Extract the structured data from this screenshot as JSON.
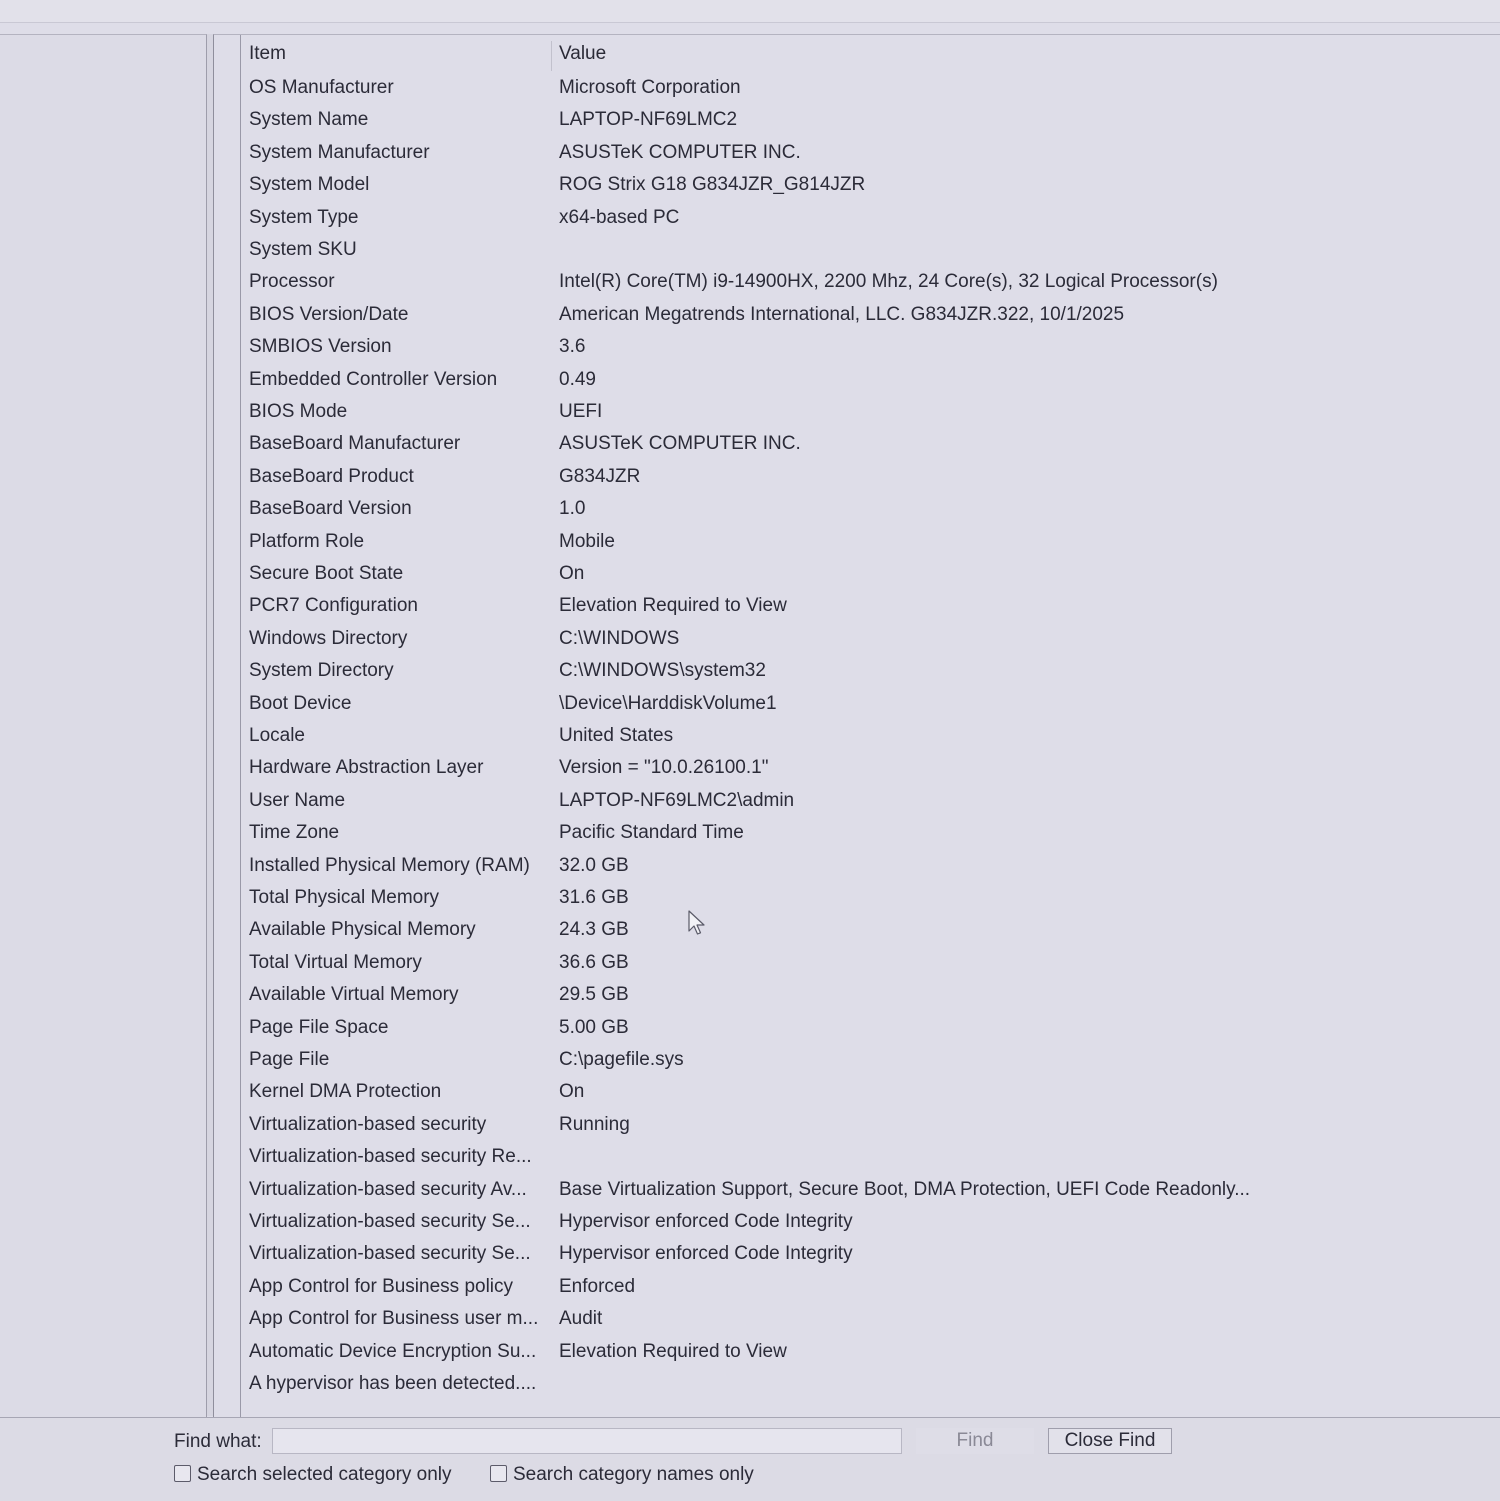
{
  "columns": {
    "item": "Item",
    "value": "Value"
  },
  "rows": [
    {
      "item": "OS Manufacturer",
      "value": "Microsoft Corporation"
    },
    {
      "item": "System Name",
      "value": "LAPTOP-NF69LMC2"
    },
    {
      "item": "System Manufacturer",
      "value": "ASUSTeK COMPUTER INC."
    },
    {
      "item": "System Model",
      "value": "ROG Strix G18 G834JZR_G814JZR"
    },
    {
      "item": "System Type",
      "value": "x64-based PC"
    },
    {
      "item": "System SKU",
      "value": ""
    },
    {
      "item": "Processor",
      "value": "Intel(R) Core(TM) i9-14900HX, 2200 Mhz, 24 Core(s), 32 Logical Processor(s)"
    },
    {
      "item": "BIOS Version/Date",
      "value": "American Megatrends International, LLC. G834JZR.322, 10/1/2025"
    },
    {
      "item": "SMBIOS Version",
      "value": "3.6"
    },
    {
      "item": "Embedded Controller Version",
      "value": "0.49"
    },
    {
      "item": "BIOS Mode",
      "value": "UEFI"
    },
    {
      "item": "BaseBoard Manufacturer",
      "value": "ASUSTeK COMPUTER INC."
    },
    {
      "item": "BaseBoard Product",
      "value": "G834JZR"
    },
    {
      "item": "BaseBoard Version",
      "value": "1.0"
    },
    {
      "item": "Platform Role",
      "value": "Mobile"
    },
    {
      "item": "Secure Boot State",
      "value": "On"
    },
    {
      "item": "PCR7 Configuration",
      "value": "Elevation Required to View"
    },
    {
      "item": "Windows Directory",
      "value": "C:\\WINDOWS"
    },
    {
      "item": "System Directory",
      "value": "C:\\WINDOWS\\system32"
    },
    {
      "item": "Boot Device",
      "value": "\\Device\\HarddiskVolume1"
    },
    {
      "item": "Locale",
      "value": "United States"
    },
    {
      "item": "Hardware Abstraction Layer",
      "value": "Version = \"10.0.26100.1\""
    },
    {
      "item": "User Name",
      "value": "LAPTOP-NF69LMC2\\admin"
    },
    {
      "item": "Time Zone",
      "value": "Pacific Standard Time"
    },
    {
      "item": "Installed Physical Memory (RAM)",
      "value": "32.0 GB"
    },
    {
      "item": "Total Physical Memory",
      "value": "31.6 GB"
    },
    {
      "item": "Available Physical Memory",
      "value": "24.3 GB"
    },
    {
      "item": "Total Virtual Memory",
      "value": "36.6 GB"
    },
    {
      "item": "Available Virtual Memory",
      "value": "29.5 GB"
    },
    {
      "item": "Page File Space",
      "value": "5.00 GB"
    },
    {
      "item": "Page File",
      "value": "C:\\pagefile.sys"
    },
    {
      "item": "Kernel DMA Protection",
      "value": "On"
    },
    {
      "item": "Virtualization-based security",
      "value": "Running"
    },
    {
      "item": "Virtualization-based security Re...",
      "value": ""
    },
    {
      "item": "Virtualization-based security Av...",
      "value": "Base Virtualization Support, Secure Boot, DMA Protection, UEFI Code Readonly..."
    },
    {
      "item": "Virtualization-based security Se...",
      "value": "Hypervisor enforced Code Integrity"
    },
    {
      "item": "Virtualization-based security Se...",
      "value": "Hypervisor enforced Code Integrity"
    },
    {
      "item": "App Control for Business policy",
      "value": "Enforced"
    },
    {
      "item": "App Control for Business user m...",
      "value": "Audit"
    },
    {
      "item": "Automatic Device Encryption Su...",
      "value": "Elevation Required to View"
    },
    {
      "item": "A hypervisor has been detected....",
      "value": ""
    }
  ],
  "find": {
    "label": "Find what:",
    "value": "",
    "placeholder": "",
    "find_button": "Find",
    "close_button": "Close Find",
    "option_selected_category": "Search selected category only",
    "option_category_names": "Search category names only"
  },
  "icons": {
    "cursor": "mouse-pointer-icon"
  },
  "colors": {
    "background": "#dedde8",
    "text": "#2b2b38",
    "disabled_text": "#8a8996"
  }
}
